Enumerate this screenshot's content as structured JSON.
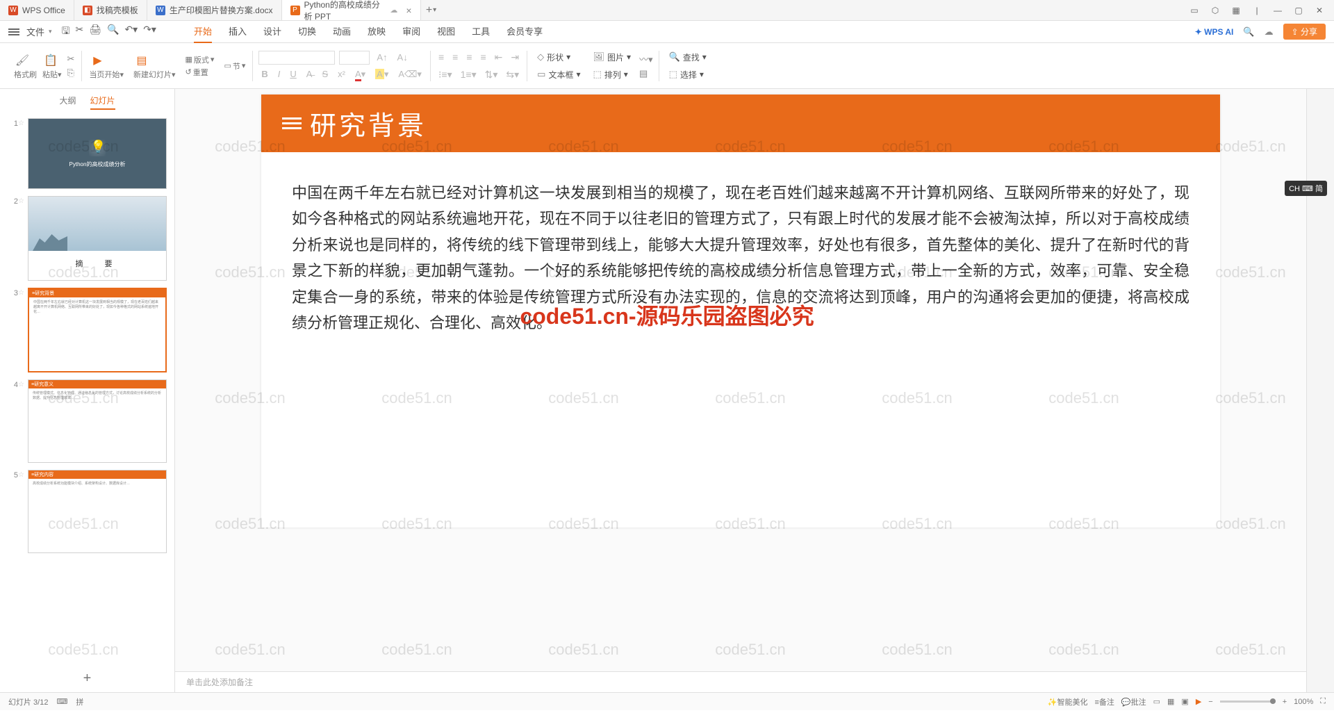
{
  "app_name": "WPS Office",
  "tabs": [
    {
      "icon_bg": "#d84a27",
      "icon_text": "",
      "label": "找稿壳模板"
    },
    {
      "icon_bg": "#3b6fca",
      "icon_text": "W",
      "label": "生产印模图片替换方案.docx"
    },
    {
      "icon_bg": "#e86a1a",
      "icon_text": "P",
      "label": "Python的高校成绩分析 PPT",
      "active": true
    }
  ],
  "file_label": "文件",
  "menu": [
    "开始",
    "插入",
    "设计",
    "切换",
    "动画",
    "放映",
    "审阅",
    "视图",
    "工具",
    "会员专享"
  ],
  "menu_active_index": 0,
  "wps_ai": "WPS AI",
  "share_btn": "分享",
  "ribbon": {
    "format_painter": "格式刷",
    "paste": "粘贴",
    "from_current": "当页开始",
    "new_slide": "新建幻灯片",
    "layout": "版式",
    "reset": "重置",
    "section": "节",
    "shape": "形状",
    "picture": "图片",
    "textbox": "文本框",
    "arrange": "排列",
    "find": "查找",
    "select": "选择"
  },
  "leftpane": {
    "tab_outline": "大纲",
    "tab_slides": "幻灯片"
  },
  "thumbs": {
    "t1_title": "Python的高校成绩分析",
    "t2_title": "摘　要",
    "t3_bar": "研究背景",
    "t4_bar": "研究意义",
    "t5_bar": "研究内容"
  },
  "slide": {
    "title": "研究背景",
    "body": "中国在两千年左右就已经对计算机这一块发展到相当的规模了，现在老百姓们越来越离不开计算机网络、互联网所带来的好处了，现如今各种格式的网站系统遍地开花，现在不同于以往老旧的管理方式了，只有跟上时代的发展才能不会被淘汰掉，所以对于高校成绩分析来说也是同样的，将传统的线下管理带到线上，能够大大提升管理效率，好处也有很多，首先整体的美化、提升了在新时代的背景之下新的样貌，更加朝气蓬勃。一个好的系统能够把传统的高校成绩分析信息管理方式，带上一全新的方式，效率，可靠、安全稳定集合一身的系统，带来的体验是传统管理方式所没有办法实现的，信息的交流将达到顶峰，用户的沟通将会更加的便捷，将高校成绩分析管理正规化、合理化、高效化。"
  },
  "notes_placeholder": "单击此处添加备注",
  "status": {
    "left": "幻灯片 3/12",
    "right_tools": [
      "智能美化",
      "备注",
      "批注"
    ],
    "zoom": "100%"
  },
  "watermark_text": "code51.cn",
  "overlay_text": "code51.cn-源码乐园盗图必究",
  "ime": "CH ⌨ 简"
}
